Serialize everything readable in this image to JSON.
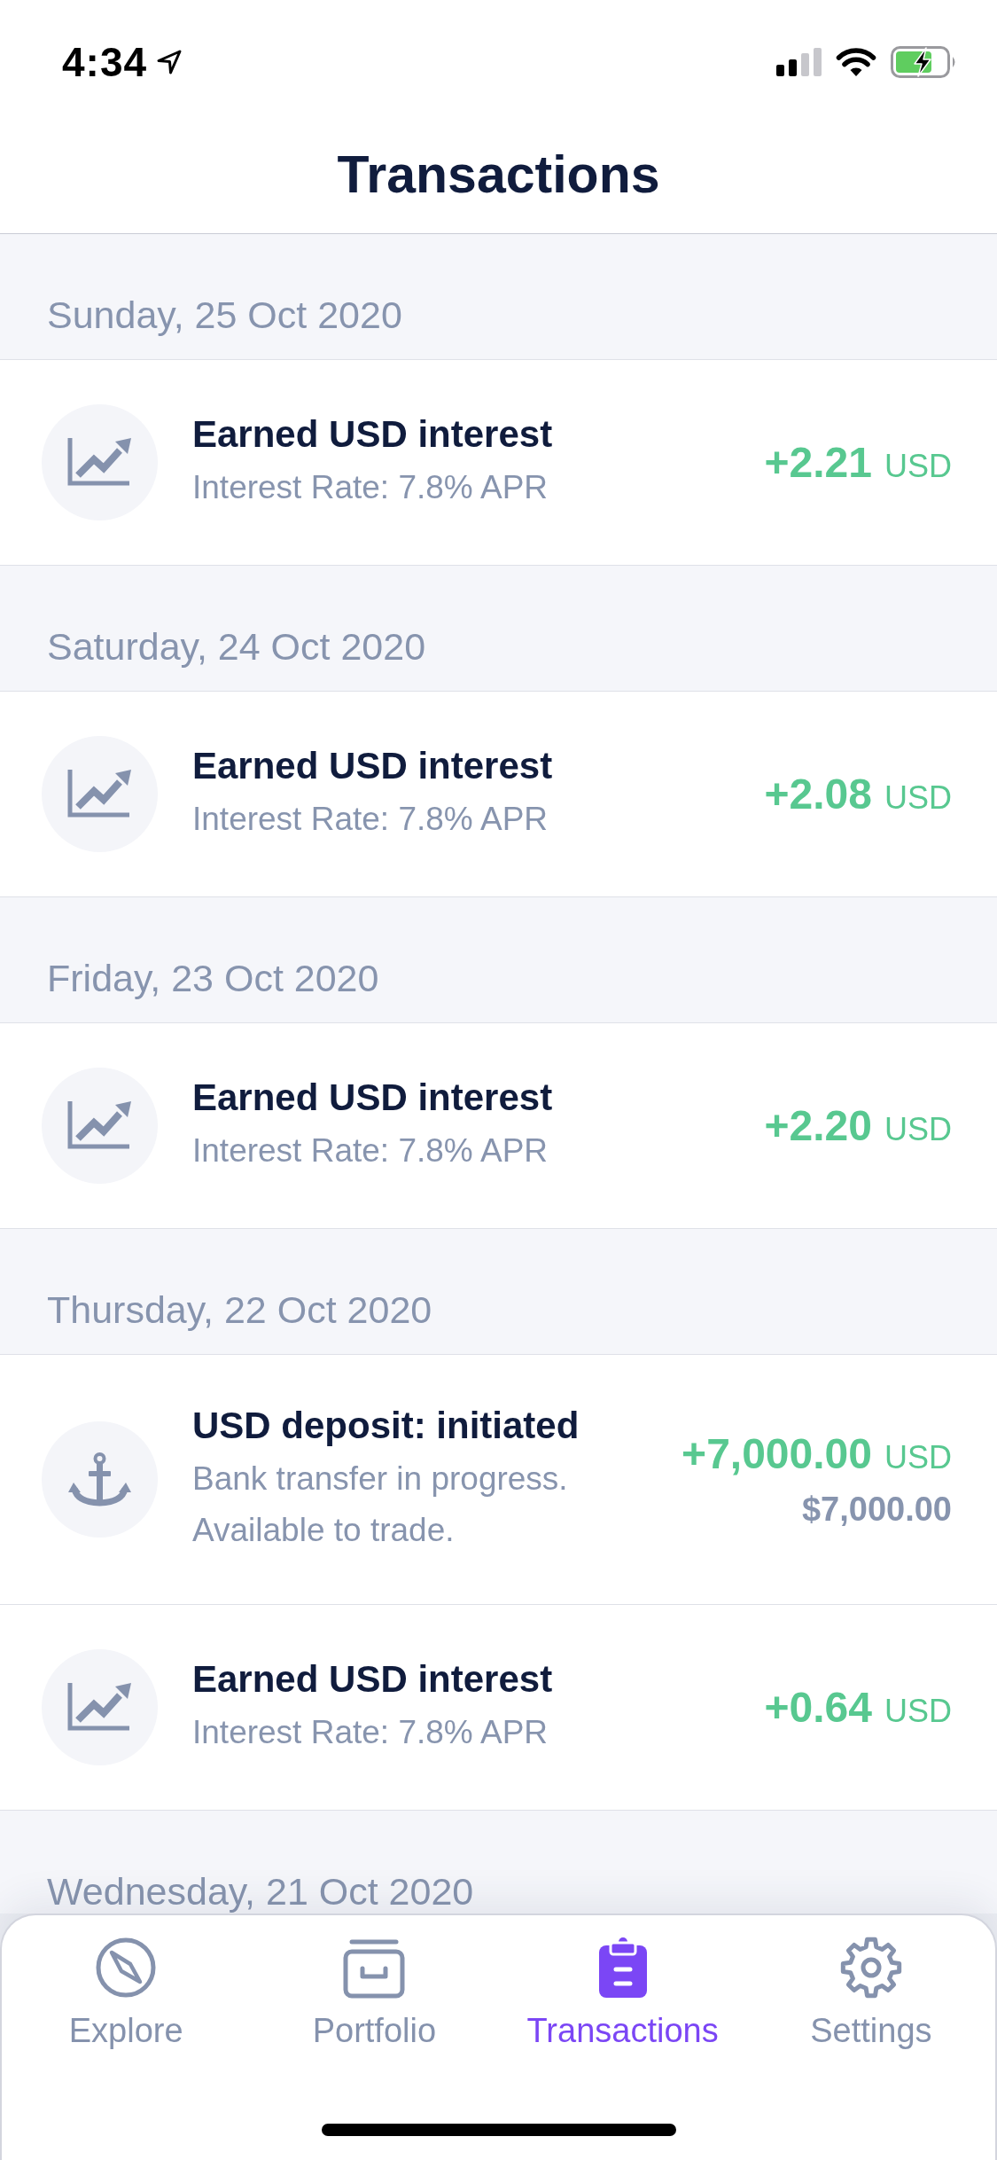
{
  "status_bar": {
    "time": "4:34"
  },
  "header": {
    "title": "Transactions"
  },
  "sections": [
    {
      "date": "Sunday, 25 Oct 2020",
      "transactions": [
        {
          "kind": "interest",
          "title": "Earned USD interest",
          "subtitle": "Interest Rate: 7.8% APR",
          "amount": "+2.21",
          "currency": "USD"
        }
      ]
    },
    {
      "date": "Saturday, 24 Oct 2020",
      "transactions": [
        {
          "kind": "interest",
          "title": "Earned USD interest",
          "subtitle": "Interest Rate: 7.8% APR",
          "amount": "+2.08",
          "currency": "USD"
        }
      ]
    },
    {
      "date": "Friday, 23 Oct 2020",
      "transactions": [
        {
          "kind": "interest",
          "title": "Earned USD interest",
          "subtitle": "Interest Rate: 7.8% APR",
          "amount": "+2.20",
          "currency": "USD"
        }
      ]
    },
    {
      "date": "Thursday, 22 Oct 2020",
      "transactions": [
        {
          "kind": "deposit",
          "title": "USD deposit: initiated",
          "subtitle": "Bank transfer in progress. Available to trade.",
          "amount": "+7,000.00",
          "currency": "USD",
          "fiat_value": "$7,000.00"
        },
        {
          "kind": "interest",
          "title": "Earned USD interest",
          "subtitle": "Interest Rate: 7.8% APR",
          "amount": "+0.64",
          "currency": "USD"
        }
      ]
    },
    {
      "date": "Wednesday, 21 Oct 2020"
    }
  ],
  "tab_bar": {
    "tabs": [
      {
        "label": "Explore",
        "selected": false
      },
      {
        "label": "Portfolio",
        "selected": false
      },
      {
        "label": "Transactions",
        "selected": true
      },
      {
        "label": "Settings",
        "selected": false
      }
    ]
  }
}
